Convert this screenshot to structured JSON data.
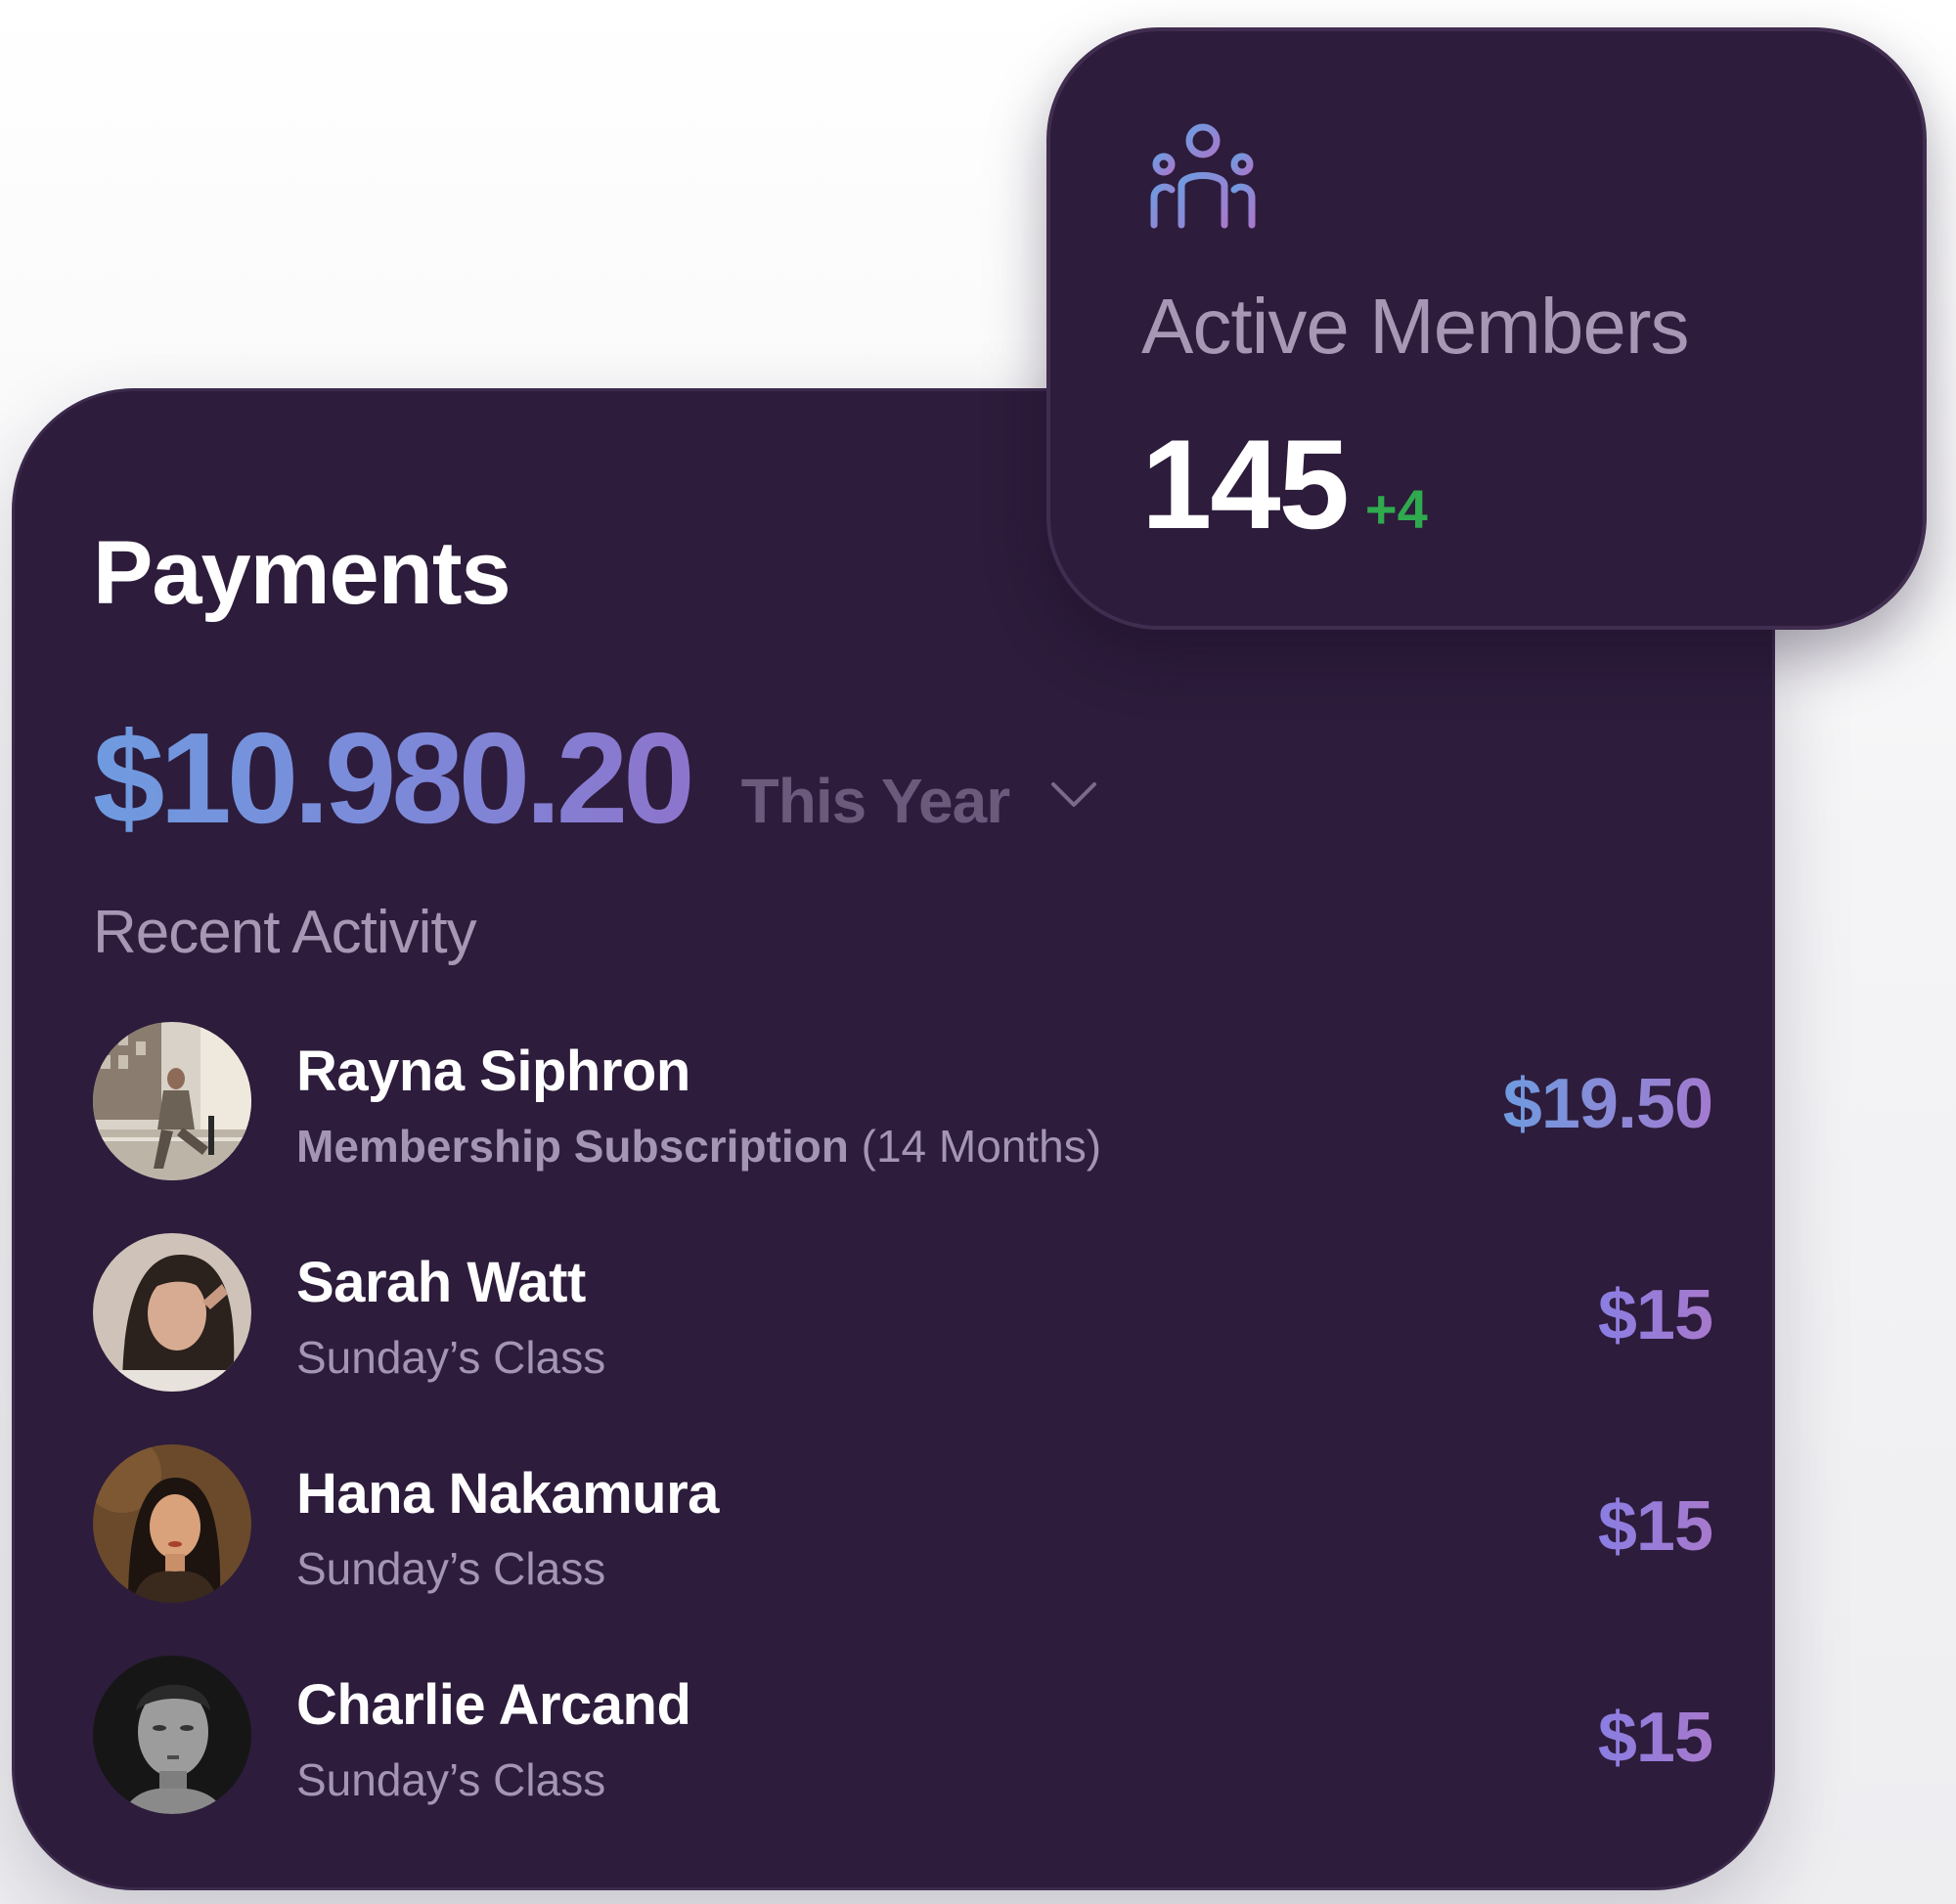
{
  "payments": {
    "title": "Payments",
    "total": "$10.980.20",
    "period": "This Year",
    "recent_title": "Recent Activity",
    "activities": [
      {
        "name": "Rayna Siphron",
        "desc_strong": "Membership Subscription",
        "desc_extra": "(14 Months)",
        "amount": "$19.50"
      },
      {
        "name": "Sarah Watt",
        "desc_strong": "",
        "desc_extra": "Sunday’s Class",
        "amount": "$15"
      },
      {
        "name": "Hana Nakamura",
        "desc_strong": "",
        "desc_extra": "Sunday’s Class",
        "amount": "$15"
      },
      {
        "name": "Charlie Arcand",
        "desc_strong": "",
        "desc_extra": "Sunday’s Class",
        "amount": "$15"
      }
    ]
  },
  "members": {
    "icon": "members-group-icon",
    "title": "Active Members",
    "count": "145",
    "delta": "+4"
  },
  "colors": {
    "card_background": "#2d1c3b",
    "accent_blue": "#6f9be0",
    "accent_purple": "#a779cc",
    "positive_green": "#2faa4e",
    "muted_text": "#a797b5"
  }
}
